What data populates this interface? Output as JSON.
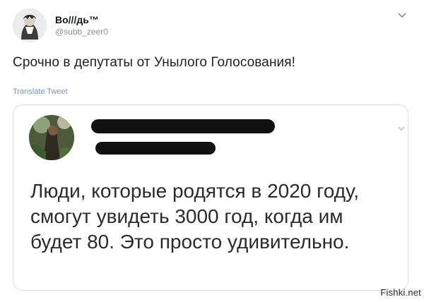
{
  "author": {
    "name": "Во///дь™",
    "handle": "@subb_zeer0"
  },
  "tweet": {
    "text": "Срочно в депутаты от Унылого Голосования!",
    "translate_label": "Translate Tweet"
  },
  "quoted_tweet": {
    "text": "Люди, которые родятся в 2020 году, смогут увидеть 3000 год, когда им будет 80. Это просто удивительно."
  },
  "watermark": "Fishki.net",
  "icons": {
    "menu": "chevron-down-icon",
    "quoted_menu": "chevron-down-icon"
  }
}
